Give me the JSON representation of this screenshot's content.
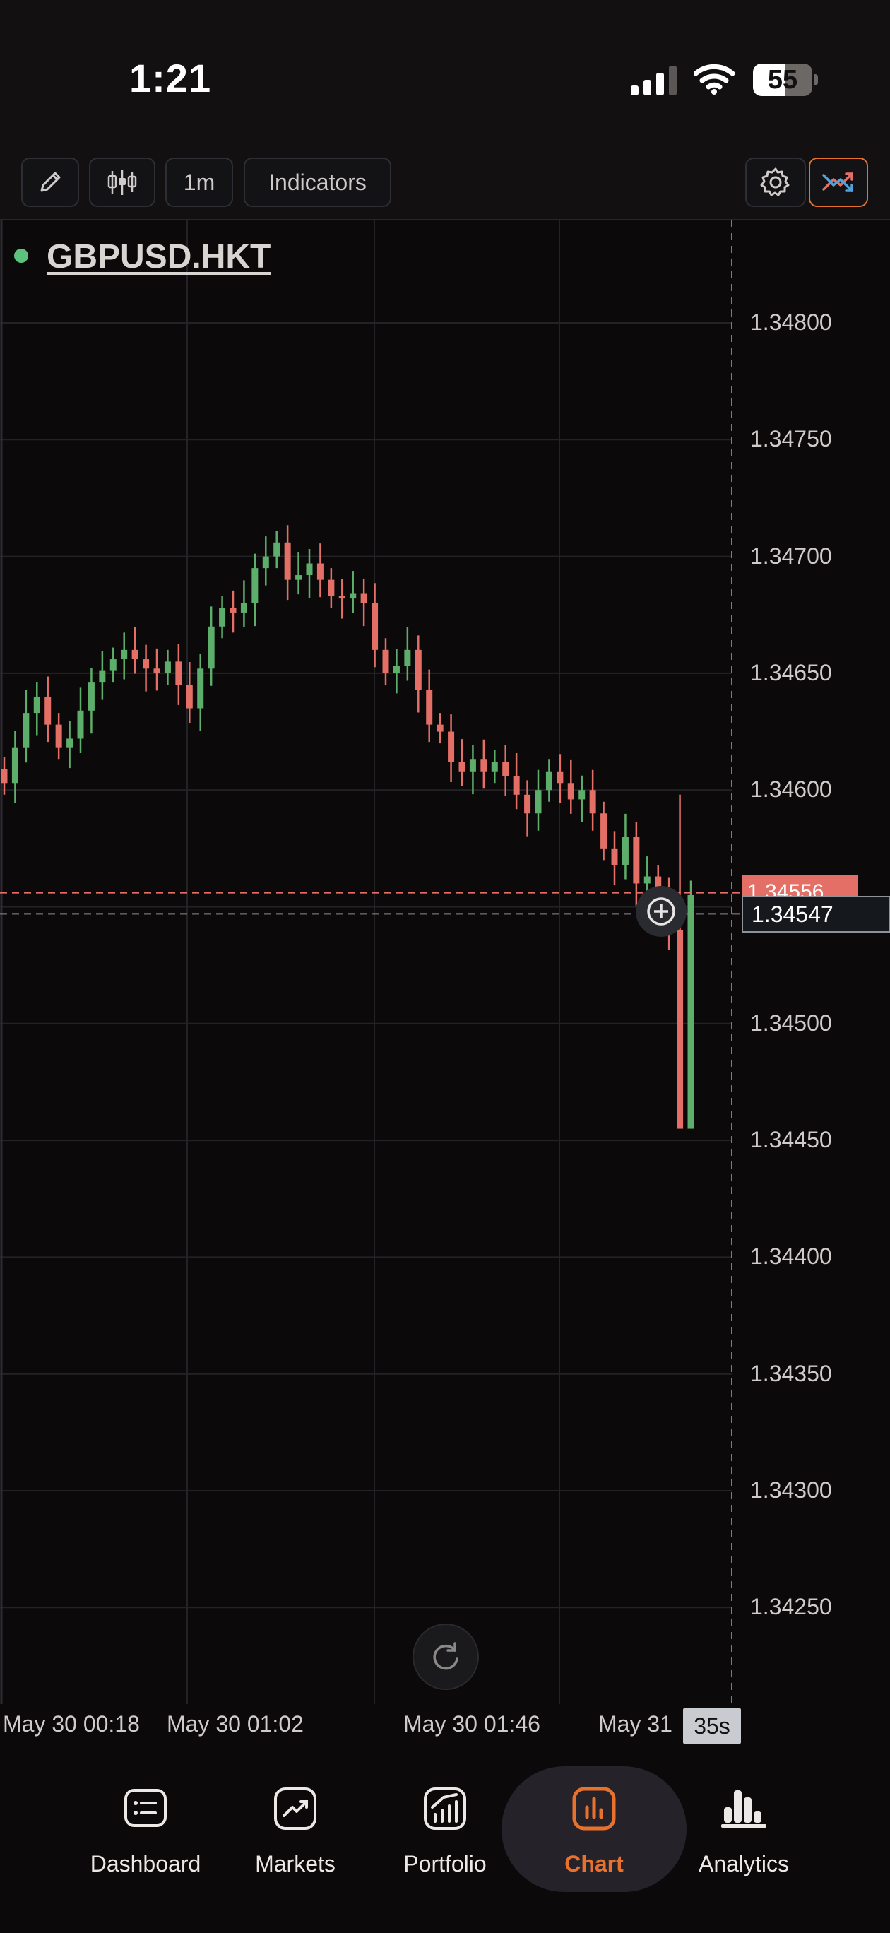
{
  "status_bar": {
    "time": "1:21",
    "battery": "55",
    "battery_level": 0.55
  },
  "toolbar": {
    "draw_icon": "pencil-icon",
    "chart_type_icon": "candlestick-icon",
    "interval": "1m",
    "indicators": "Indicators",
    "settings_icon": "gear-icon",
    "trade_icon": "trend-arrows-icon"
  },
  "chart": {
    "symbol": "GBPUSD.HKT",
    "last_price_label": "1.34556",
    "crosshair_price_label": "1.34547",
    "countdown": "35s",
    "colors": {
      "up": "#5cae6a",
      "down": "#e36f66",
      "background": "#0c090a",
      "grid": "#232327",
      "accent": "#e9712e"
    }
  },
  "chart_data": {
    "type": "candlestick",
    "symbol": "GBPUSD.HKT",
    "interval": "1m",
    "y_ticks": [
      "1.34800",
      "1.34750",
      "1.34700",
      "1.34650",
      "1.34600",
      "1.34500",
      "1.34450",
      "1.34400",
      "1.34350",
      "1.34300",
      "1.34250"
    ],
    "x_ticks": [
      "May 30 00:18",
      "May 30 01:02",
      "May 30 01:46",
      "May 31"
    ],
    "ylim": [
      1.34225,
      1.3482
    ],
    "last_price": 1.34556,
    "crosshair_price": 1.34547,
    "close_path": [
      1.34603,
      1.34618,
      1.34633,
      1.3464,
      1.34628,
      1.34618,
      1.34622,
      1.34634,
      1.34646,
      1.34651,
      1.34656,
      1.3466,
      1.34656,
      1.34652,
      1.3465,
      1.34655,
      1.34645,
      1.34635,
      1.34652,
      1.3467,
      1.34678,
      1.34676,
      1.3468,
      1.34695,
      1.347,
      1.34706,
      1.3469,
      1.34692,
      1.34697,
      1.3469,
      1.34683,
      1.34682,
      1.34684,
      1.3468,
      1.3466,
      1.3465,
      1.34653,
      1.3466,
      1.34643,
      1.34628,
      1.34625,
      1.34612,
      1.34608,
      1.34613,
      1.34608,
      1.34612,
      1.34606,
      1.34598,
      1.3459,
      1.346,
      1.34608,
      1.34603,
      1.34596,
      1.346,
      1.3459,
      1.34575,
      1.34568,
      1.3458,
      1.3456,
      1.34563,
      1.34555,
      1.3454,
      1.34455,
      1.34555
    ],
    "low_extreme": 1.34458,
    "high_extreme": 1.34598
  },
  "nav": {
    "items": [
      {
        "label": "Dashboard",
        "icon": "dashboard-icon"
      },
      {
        "label": "Markets",
        "icon": "markets-icon"
      },
      {
        "label": "Portfolio",
        "icon": "portfolio-icon"
      },
      {
        "label": "Chart",
        "icon": "chart-bars-icon"
      },
      {
        "label": "Analytics",
        "icon": "analytics-icon"
      }
    ],
    "active": "Chart"
  }
}
